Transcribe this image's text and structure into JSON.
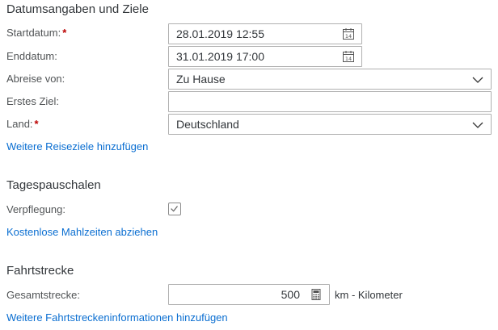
{
  "dates_section": {
    "title": "Datumsangaben und Ziele",
    "start_label": "Startdatum:",
    "start_value": "28.01.2019 12:55",
    "end_label": "Enddatum:",
    "end_value": "31.01.2019 17:00",
    "departure_label": "Abreise von:",
    "departure_value": "Zu Hause",
    "first_destination_label": "Erstes Ziel:",
    "first_destination_value": "",
    "country_label": "Land:",
    "country_value": "Deutschland",
    "required_marker": "*",
    "add_destinations_link": "Weitere Reiseziele hinzufügen"
  },
  "allowance_section": {
    "title": "Tagespauschalen",
    "meals_label": "Verpflegung:",
    "meals_checked": true,
    "deduct_meals_link": "Kostenlose Mahlzeiten abziehen"
  },
  "distance_section": {
    "title": "Fahrtstrecke",
    "total_label": "Gesamtstrecke:",
    "total_value": "500",
    "unit_label": "km - Kilometer",
    "add_distance_info_link": "Weitere Fahrtstreckeninformationen hinzufügen"
  },
  "icons": {
    "calendar": "calendar-icon",
    "dropdown": "chevron-down-icon",
    "calculator": "calculator-icon",
    "checkmark": "checkmark-icon"
  },
  "colors": {
    "link": "#0a6ed1",
    "required": "#bb0000",
    "text": "#32363a",
    "label": "#515456",
    "border": "#b0b0b0"
  }
}
